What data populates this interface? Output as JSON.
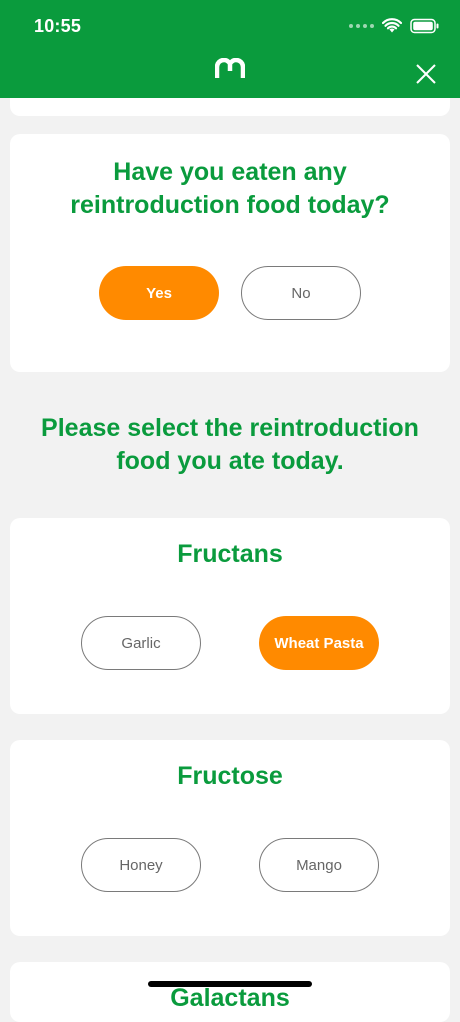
{
  "status_bar": {
    "time": "10:55"
  },
  "header": {
    "logo_text": "m",
    "brand_color": "#0a9b3d",
    "close_icon": "close-icon"
  },
  "question_card": {
    "question": "Have you eaten any reintroduction food today?",
    "options": [
      {
        "label": "Yes",
        "selected": true
      },
      {
        "label": "No",
        "selected": false
      }
    ]
  },
  "selection_prompt": "Please select the reintroduction food you ate today.",
  "categories": [
    {
      "name": "Fructans",
      "foods": [
        {
          "label": "Garlic",
          "selected": false
        },
        {
          "label": "Wheat Pasta",
          "selected": true
        }
      ]
    },
    {
      "name": "Fructose",
      "foods": [
        {
          "label": "Honey",
          "selected": false
        },
        {
          "label": "Mango",
          "selected": false
        }
      ]
    },
    {
      "name": "Galactans",
      "foods": []
    }
  ],
  "colors": {
    "accent_orange": "#ff8a00",
    "text_green": "#0a9b3d",
    "background": "#f2f2f2"
  }
}
